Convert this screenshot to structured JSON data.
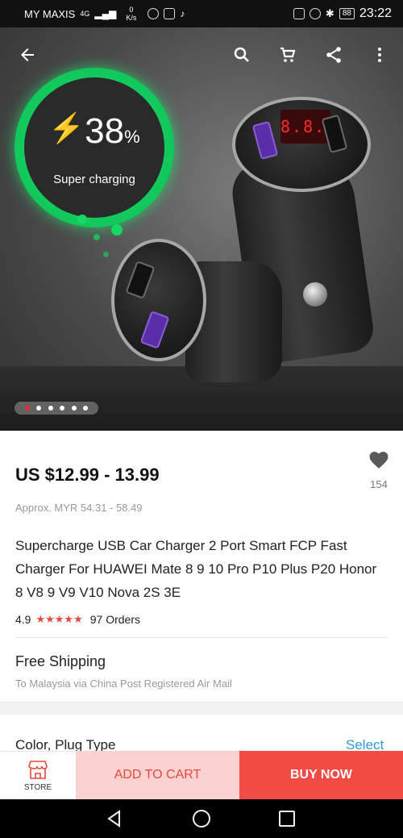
{
  "status_bar": {
    "carrier": "MY MAXIS",
    "network": "4G",
    "speed_value": "0",
    "speed_unit": "K/s",
    "battery": "88",
    "time": "23:22"
  },
  "hero": {
    "badge_value": "38",
    "badge_unit": "%",
    "badge_label": "Super charging",
    "lcd_text": "8.8.8",
    "carousel": {
      "count": 6,
      "active_index": 0
    }
  },
  "product": {
    "price": "US $12.99 - 13.99",
    "approx_price": "Approx. MYR 54.31 - 58.49",
    "wishlist_count": "154",
    "title": "Supercharge USB Car Charger 2 Port Smart FCP Fast Charger For HUAWEI Mate 8 9 10 Pro P10 Plus P20 Honor 8 V8 9 V9 V10 Nova 2S 3E",
    "rating": "4.9",
    "stars": "★★★★★",
    "orders": "97 Orders"
  },
  "shipping": {
    "title": "Free Shipping",
    "subtitle": "To Malaysia via China Post Registered Air Mail"
  },
  "variant": {
    "label": "Color, Plug Type",
    "action": "Select"
  },
  "actions": {
    "store_label": "STORE",
    "add_to_cart": "ADD TO CART",
    "buy_now": "BUY NOW"
  },
  "colors": {
    "accent_red": "#f24a45",
    "cart_bg": "#fbd2d0",
    "link_blue": "#2b9bd6",
    "badge_green": "#17e36a"
  },
  "icons": [
    "back-icon",
    "search-icon",
    "cart-icon",
    "share-icon",
    "more-icon",
    "heart-icon",
    "store-icon",
    "nav-back-icon",
    "nav-home-icon",
    "nav-recents-icon"
  ]
}
